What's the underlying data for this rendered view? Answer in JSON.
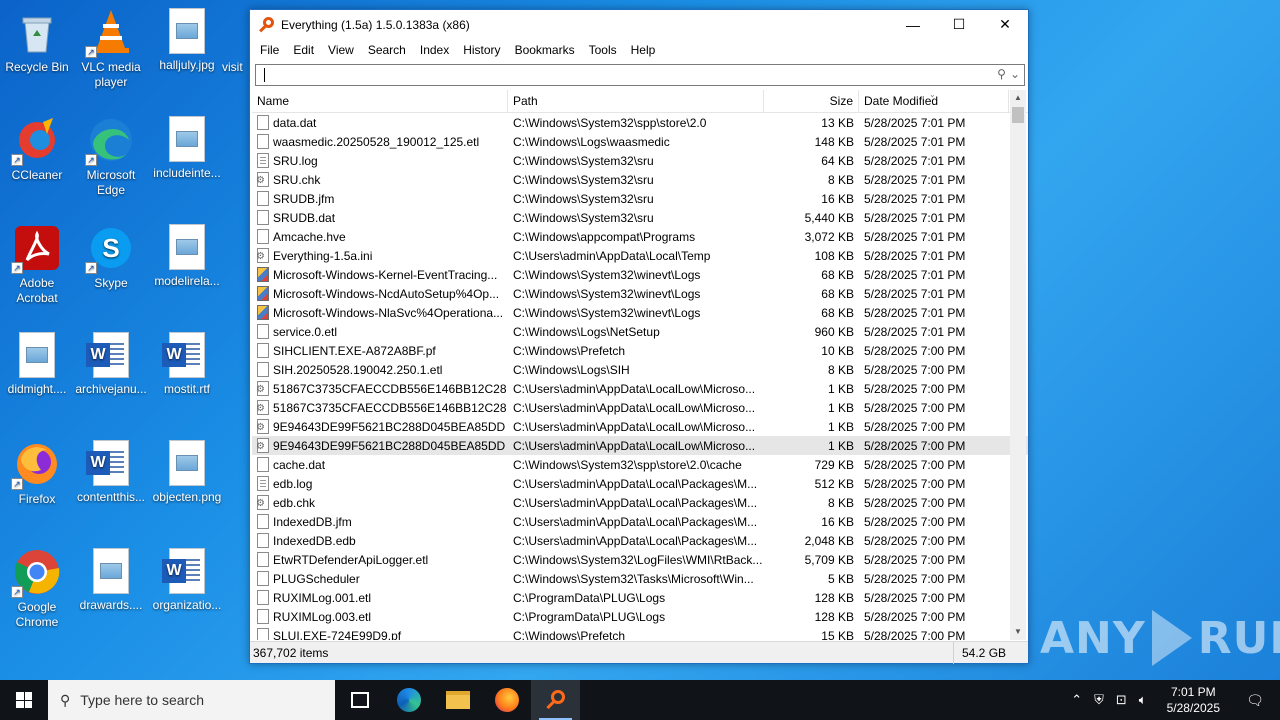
{
  "desktop": {
    "icons": [
      {
        "label": "Recycle Bin"
      },
      {
        "label": "VLC media player"
      },
      {
        "label": "halljuly.jpg"
      },
      {
        "label": "visit"
      },
      {
        "label": "CCleaner"
      },
      {
        "label": "Microsoft Edge"
      },
      {
        "label": "includeinte..."
      },
      {
        "label": "Adobe Acrobat"
      },
      {
        "label": "Skype"
      },
      {
        "label": "modelirela..."
      },
      {
        "label": "didmight...."
      },
      {
        "label": "archivejanu..."
      },
      {
        "label": "mostit.rtf"
      },
      {
        "label": "Firefox"
      },
      {
        "label": "contentthis..."
      },
      {
        "label": "objecten.png"
      },
      {
        "label": "Google Chrome"
      },
      {
        "label": "drawards...."
      },
      {
        "label": "organizatio..."
      }
    ]
  },
  "window": {
    "title": "Everything (1.5a) 1.5.0.1383a (x86)",
    "controls": {
      "minimize": "—",
      "maximize": "☐",
      "close": "✕"
    },
    "menu": [
      "File",
      "Edit",
      "View",
      "Search",
      "Index",
      "History",
      "Bookmarks",
      "Tools",
      "Help"
    ],
    "search": {
      "value": "",
      "placeholder": ""
    },
    "columns": {
      "name": "Name",
      "path": "Path",
      "size": "Size",
      "date": "Date Modified"
    },
    "rows": [
      {
        "icon": "blank",
        "name": "data.dat",
        "path": "C:\\Windows\\System32\\spp\\store\\2.0",
        "size": "13 KB",
        "date": "5/28/2025 7:01 PM"
      },
      {
        "icon": "blank",
        "name": "waasmedic.20250528_190012_125.etl",
        "path": "C:\\Windows\\Logs\\waasmedic",
        "size": "148 KB",
        "date": "5/28/2025 7:01 PM"
      },
      {
        "icon": "log",
        "name": "SRU.log",
        "path": "C:\\Windows\\System32\\sru",
        "size": "64 KB",
        "date": "5/28/2025 7:01 PM"
      },
      {
        "icon": "gear",
        "name": "SRU.chk",
        "path": "C:\\Windows\\System32\\sru",
        "size": "8 KB",
        "date": "5/28/2025 7:01 PM"
      },
      {
        "icon": "blank",
        "name": "SRUDB.jfm",
        "path": "C:\\Windows\\System32\\sru",
        "size": "16 KB",
        "date": "5/28/2025 7:01 PM"
      },
      {
        "icon": "blank",
        "name": "SRUDB.dat",
        "path": "C:\\Windows\\System32\\sru",
        "size": "5,440 KB",
        "date": "5/28/2025 7:01 PM"
      },
      {
        "icon": "blank",
        "name": "Amcache.hve",
        "path": "C:\\Windows\\appcompat\\Programs",
        "size": "3,072 KB",
        "date": "5/28/2025 7:01 PM"
      },
      {
        "icon": "gear",
        "name": "Everything-1.5a.ini",
        "path": "C:\\Users\\admin\\AppData\\Local\\Temp",
        "size": "108 KB",
        "date": "5/28/2025 7:01 PM"
      },
      {
        "icon": "evt",
        "name": "Microsoft-Windows-Kernel-EventTracing...",
        "path": "C:\\Windows\\System32\\winevt\\Logs",
        "size": "68 KB",
        "date": "5/28/2025 7:01 PM"
      },
      {
        "icon": "evt",
        "name": "Microsoft-Windows-NcdAutoSetup%4Op...",
        "path": "C:\\Windows\\System32\\winevt\\Logs",
        "size": "68 KB",
        "date": "5/28/2025 7:01 PM"
      },
      {
        "icon": "evt",
        "name": "Microsoft-Windows-NlaSvc%4Operationa...",
        "path": "C:\\Windows\\System32\\winevt\\Logs",
        "size": "68 KB",
        "date": "5/28/2025 7:01 PM"
      },
      {
        "icon": "blank",
        "name": "service.0.etl",
        "path": "C:\\Windows\\Logs\\NetSetup",
        "size": "960 KB",
        "date": "5/28/2025 7:01 PM"
      },
      {
        "icon": "blank",
        "name": "SIHCLIENT.EXE-A872A8BF.pf",
        "path": "C:\\Windows\\Prefetch",
        "size": "10 KB",
        "date": "5/28/2025 7:00 PM"
      },
      {
        "icon": "blank",
        "name": "SIH.20250528.190042.250.1.etl",
        "path": "C:\\Windows\\Logs\\SIH",
        "size": "8 KB",
        "date": "5/28/2025 7:00 PM"
      },
      {
        "icon": "gear",
        "name": "51867C3735CFAECCDB556E146BB12C28",
        "path": "C:\\Users\\admin\\AppData\\LocalLow\\Microso...",
        "size": "1 KB",
        "date": "5/28/2025 7:00 PM"
      },
      {
        "icon": "gear",
        "name": "51867C3735CFAECCDB556E146BB12C28",
        "path": "C:\\Users\\admin\\AppData\\LocalLow\\Microso...",
        "size": "1 KB",
        "date": "5/28/2025 7:00 PM"
      },
      {
        "icon": "gear",
        "name": "9E94643DE99F5621BC288D045BEA85DD",
        "path": "C:\\Users\\admin\\AppData\\LocalLow\\Microso...",
        "size": "1 KB",
        "date": "5/28/2025 7:00 PM"
      },
      {
        "icon": "gear",
        "name": "9E94643DE99F5621BC288D045BEA85DD",
        "path": "C:\\Users\\admin\\AppData\\LocalLow\\Microso...",
        "size": "1 KB",
        "date": "5/28/2025 7:00 PM",
        "selected": true
      },
      {
        "icon": "blank",
        "name": "cache.dat",
        "path": "C:\\Windows\\System32\\spp\\store\\2.0\\cache",
        "size": "729 KB",
        "date": "5/28/2025 7:00 PM"
      },
      {
        "icon": "log",
        "name": "edb.log",
        "path": "C:\\Users\\admin\\AppData\\Local\\Packages\\M...",
        "size": "512 KB",
        "date": "5/28/2025 7:00 PM"
      },
      {
        "icon": "gear",
        "name": "edb.chk",
        "path": "C:\\Users\\admin\\AppData\\Local\\Packages\\M...",
        "size": "8 KB",
        "date": "5/28/2025 7:00 PM"
      },
      {
        "icon": "blank",
        "name": "IndexedDB.jfm",
        "path": "C:\\Users\\admin\\AppData\\Local\\Packages\\M...",
        "size": "16 KB",
        "date": "5/28/2025 7:00 PM"
      },
      {
        "icon": "blank",
        "name": "IndexedDB.edb",
        "path": "C:\\Users\\admin\\AppData\\Local\\Packages\\M...",
        "size": "2,048 KB",
        "date": "5/28/2025 7:00 PM"
      },
      {
        "icon": "blank",
        "name": "EtwRTDefenderApiLogger.etl",
        "path": "C:\\Windows\\System32\\LogFiles\\WMI\\RtBack...",
        "size": "5,709 KB",
        "date": "5/28/2025 7:00 PM"
      },
      {
        "icon": "blank",
        "name": "PLUGScheduler",
        "path": "C:\\Windows\\System32\\Tasks\\Microsoft\\Win...",
        "size": "5 KB",
        "date": "5/28/2025 7:00 PM"
      },
      {
        "icon": "blank",
        "name": "RUXIMLog.001.etl",
        "path": "C:\\ProgramData\\PLUG\\Logs",
        "size": "128 KB",
        "date": "5/28/2025 7:00 PM"
      },
      {
        "icon": "blank",
        "name": "RUXIMLog.003.etl",
        "path": "C:\\ProgramData\\PLUG\\Logs",
        "size": "128 KB",
        "date": "5/28/2025 7:00 PM"
      },
      {
        "icon": "blank",
        "name": "SLUI.EXE-724E99D9.pf",
        "path": "C:\\Windows\\Prefetch",
        "size": "15 KB",
        "date": "5/28/2025 7:00 PM"
      }
    ],
    "status": {
      "count": "367,702 items",
      "total_size": "54.2 GB"
    }
  },
  "watermark": {
    "left": "ANY",
    "right": "RUN"
  },
  "taskbar": {
    "search_placeholder": "Type here to search",
    "apps": [
      "task-view",
      "edge",
      "file-explorer",
      "firefox",
      "everything"
    ],
    "clock": {
      "time": "7:01 PM",
      "date": "5/28/2025"
    }
  }
}
